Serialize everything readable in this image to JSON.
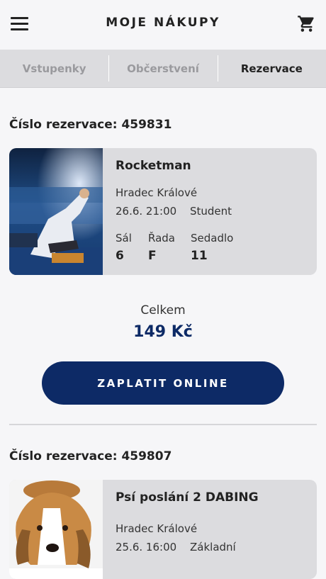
{
  "header": {
    "title": "MOJE NÁKUPY",
    "menu_icon": "hamburger-menu-icon",
    "cart_icon": "shopping-cart-icon"
  },
  "tabs": [
    {
      "label": "Vstupenky",
      "active": false
    },
    {
      "label": "Občerstvení",
      "active": false
    },
    {
      "label": "Rezervace",
      "active": true
    }
  ],
  "reservations": [
    {
      "number_label": "Číslo rezervace: 459831",
      "film": "Rocketman",
      "city": "Hradec Králové",
      "datetime": "26.6. 21:00",
      "ticket_type": "Student",
      "hall_label": "Sál",
      "hall": "6",
      "row_label": "Řada",
      "row": "F",
      "seat_label": "Sedadlo",
      "seat": "11",
      "total_label": "Celkem",
      "total": "149 Kč",
      "pay_label": "ZAPLATIT ONLINE"
    },
    {
      "number_label": "Číslo rezervace: 459807",
      "film": "Psí poslání 2 DABING",
      "city": "Hradec Králové",
      "datetime": "25.6. 16:00",
      "ticket_type": "Základní"
    }
  ],
  "colors": {
    "accent": "#0d2a66",
    "card": "#dcdcdf",
    "background": "#f6f6f8"
  }
}
